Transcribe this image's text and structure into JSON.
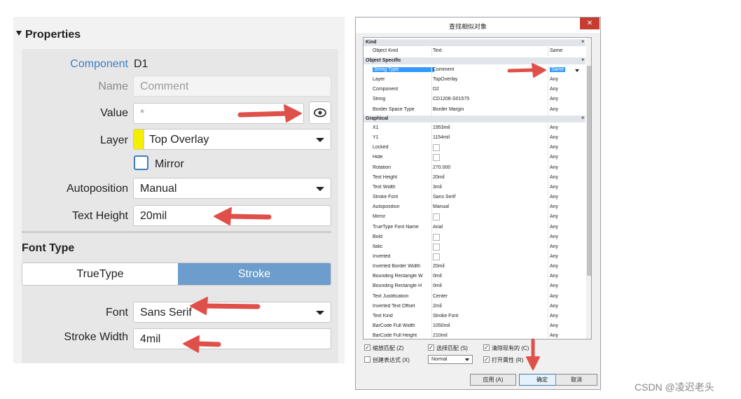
{
  "properties": {
    "section_title": "Properties",
    "component": {
      "label": "Component",
      "value": "D1"
    },
    "name": {
      "label": "Name",
      "placeholder": "Comment"
    },
    "value": {
      "label": "Value",
      "placeholder": "*"
    },
    "layer": {
      "label": "Layer",
      "value": "Top Overlay",
      "color": "#f4ef00"
    },
    "mirror": {
      "label": "Mirror",
      "checked": false
    },
    "autoposition": {
      "label": "Autoposition",
      "value": "Manual"
    },
    "text_height": {
      "label": "Text Height",
      "value": "20mil"
    },
    "font_type": {
      "title": "Font Type",
      "options": [
        "TrueType",
        "Stroke"
      ],
      "selected": "Stroke"
    },
    "font": {
      "label": "Font",
      "value": "Sans Serif"
    },
    "stroke_width": {
      "label": "Stroke Width",
      "value": "4mil"
    },
    "accent_color": "#6c9dcc"
  },
  "dialog": {
    "title": "查找相似对象",
    "close": "✕",
    "groups": {
      "kind": {
        "name": "Kind",
        "rows": [
          {
            "name": "Object Kind",
            "value": "Text",
            "scope": "Same"
          }
        ]
      },
      "object_specific": {
        "name": "Object Specific",
        "rows": [
          {
            "name": "String Type",
            "value": "Comment",
            "scope": "Same"
          },
          {
            "name": "Layer",
            "value": "TopOverlay",
            "scope": "Any"
          },
          {
            "name": "Component",
            "value": "D2",
            "scope": "Any"
          },
          {
            "name": "String",
            "value": "CD1206-S01575",
            "scope": "Any"
          },
          {
            "name": "Border Space Type",
            "value": "Border Margin",
            "scope": "Any"
          }
        ]
      },
      "graphical": {
        "name": "Graphical",
        "rows": [
          {
            "name": "X1",
            "value": "1953mil",
            "scope": "Any"
          },
          {
            "name": "Y1",
            "value": "1154mil",
            "scope": "Any"
          },
          {
            "name": "Locked",
            "value": "",
            "checkbox": true,
            "scope": "Any"
          },
          {
            "name": "Hide",
            "value": "",
            "checkbox": true,
            "scope": "Any"
          },
          {
            "name": "Rotation",
            "value": "270.000",
            "scope": "Any"
          },
          {
            "name": "Text Height",
            "value": "20mil",
            "scope": "Any"
          },
          {
            "name": "Text Width",
            "value": "3mil",
            "scope": "Any"
          },
          {
            "name": "Stroke Font",
            "value": "Sans Serif",
            "scope": "Any"
          },
          {
            "name": "Autoposition",
            "value": "Manual",
            "scope": "Any"
          },
          {
            "name": "Mirror",
            "value": "",
            "checkbox": true,
            "scope": "Any"
          },
          {
            "name": "TrueType Font Name",
            "value": "Arial",
            "scope": "Any"
          },
          {
            "name": "Bold",
            "value": "",
            "checkbox": true,
            "scope": "Any"
          },
          {
            "name": "Italic",
            "value": "",
            "checkbox": true,
            "scope": "Any"
          },
          {
            "name": "Inverted",
            "value": "",
            "checkbox": true,
            "scope": "Any"
          },
          {
            "name": "Inverted Border Width",
            "value": "20mil",
            "scope": "Any"
          },
          {
            "name": "Bounding Rectangle W",
            "value": "0mil",
            "scope": "Any"
          },
          {
            "name": "Bounding Rectangle H",
            "value": "0mil",
            "scope": "Any"
          },
          {
            "name": "Text Justification",
            "value": "Center",
            "scope": "Any"
          },
          {
            "name": "Inverted Text Offset",
            "value": "2mil",
            "scope": "Any"
          },
          {
            "name": "Text Kind",
            "value": "Stroke Font",
            "scope": "Any"
          },
          {
            "name": "BarCode Full Width",
            "value": "1050mil",
            "scope": "Any"
          },
          {
            "name": "BarCode Full Height",
            "value": "210mil",
            "scope": "Any"
          }
        ]
      }
    },
    "group_toggle": "»",
    "options": {
      "zoom_match": {
        "label": "缩放匹配 (Z)",
        "checked": true
      },
      "select_match": {
        "label": "选择匹配 (S)",
        "checked": true
      },
      "clear_existing": {
        "label": "清除现有的 (C)",
        "checked": true
      },
      "create_expression": {
        "label": "创建表达式 (X)",
        "checked": false
      },
      "open_inspector": {
        "label": "打开属性 (R)",
        "checked": true
      },
      "mode_select": "Normal"
    },
    "buttons": {
      "apply": "应用 (A)",
      "ok": "确定",
      "cancel": "取消"
    }
  },
  "watermark": "CSDN @凌迟老头"
}
